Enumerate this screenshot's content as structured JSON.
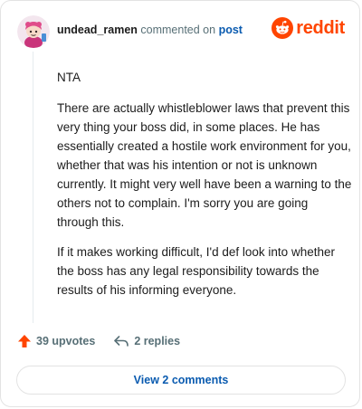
{
  "comment": {
    "username": "undead_ramen",
    "action_text": "commented on",
    "post_link": "post",
    "paragraphs": [
      "NTA",
      "There are actually whistleblower laws that prevent this very thing your boss did, in some places. He has essentially created a hostile work environment for you, whether that was his intention or not is unknown currently. It might very well have been a warning to the others not to complain. I'm sorry you are going through this.",
      "If it makes working difficult, I'd def look into whether the boss has any legal responsibility towards the results of his informing everyone."
    ]
  },
  "brand": {
    "name": "reddit",
    "color": "#ff4500",
    "icon": "reddit-snoo-icon"
  },
  "actions": {
    "upvotes": "39 upvotes",
    "replies": "2 replies",
    "upvote_icon": "upvote-arrow-icon",
    "reply_icon": "reply-arrow-icon",
    "upvote_color": "#ff4500"
  },
  "footer": {
    "view_comments": "View 2 comments"
  },
  "colors": {
    "link": "#0a5bb0",
    "muted": "#576f76",
    "border": "#e3e3e3"
  }
}
